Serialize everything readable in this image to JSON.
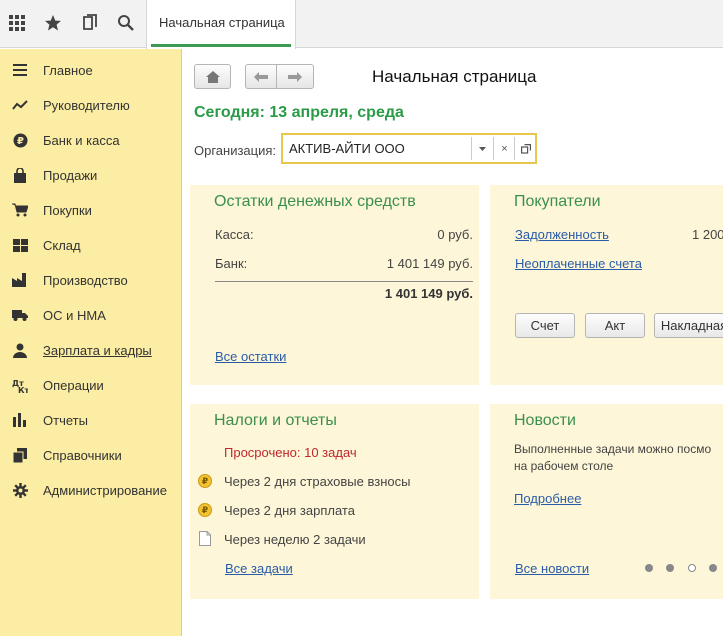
{
  "topbar": {
    "tab_label": "Начальная страница"
  },
  "sidebar": {
    "items": [
      {
        "label": "Главное",
        "icon": "menu-icon"
      },
      {
        "label": "Руководителю",
        "icon": "trend-icon"
      },
      {
        "label": "Банк и касса",
        "icon": "ruble-icon"
      },
      {
        "label": "Продажи",
        "icon": "bag-icon"
      },
      {
        "label": "Покупки",
        "icon": "cart-icon"
      },
      {
        "label": "Склад",
        "icon": "grid-icon"
      },
      {
        "label": "Производство",
        "icon": "factory-icon"
      },
      {
        "label": "ОС и НМА",
        "icon": "truck-icon"
      },
      {
        "label": "Зарплата и кадры",
        "icon": "person-icon"
      },
      {
        "label": "Операции",
        "icon": "dtkt-icon"
      },
      {
        "label": "Отчеты",
        "icon": "bar-chart-icon"
      },
      {
        "label": "Справочники",
        "icon": "books-icon"
      },
      {
        "label": "Администрирование",
        "icon": "gear-icon"
      }
    ]
  },
  "main": {
    "title": "Начальная страница",
    "today": "Сегодня: 13 апреля, среда",
    "org_label": "Организация:",
    "org_value": "АКТИВ-АЙТИ ООО",
    "org_clear": "×"
  },
  "cash_panel": {
    "title": "Остатки денежных средств",
    "rows": [
      {
        "label": "Касса:",
        "value": "0 руб."
      },
      {
        "label": "Банк:",
        "value": "1 401 149 руб."
      }
    ],
    "total": "1 401 149 руб.",
    "link": "Все остатки"
  },
  "buyers_panel": {
    "title": "Покупатели",
    "debt_link": "Задолженность",
    "debt_value": "1 200",
    "unpaid_link": "Неоплаченные счета",
    "buttons": [
      "Счет",
      "Акт",
      "Накладная"
    ]
  },
  "taxes_panel": {
    "title": "Налоги и отчеты",
    "overdue": "Просрочено: 10 задач",
    "tasks": [
      {
        "text": "Через 2 дня страховые взносы",
        "icon": "coin-icon"
      },
      {
        "text": "Через 2 дня зарплата",
        "icon": "coin-icon"
      },
      {
        "text": "Через неделю 2 задачи",
        "icon": "doc-icon"
      }
    ],
    "coin_glyph": "₽",
    "link": "Все задачи"
  },
  "news_panel": {
    "title": "Новости",
    "text_line1": "Выполненные задачи можно посмо",
    "text_line2": "на рабочем столе",
    "more_link": "Подробнее",
    "all_link": "Все новости"
  },
  "colors": {
    "sidebar_bg": "#fbeda3",
    "panel_bg": "#fdf6d8",
    "accent_green": "#2a9b47",
    "link_blue": "#2a5ca8",
    "overdue_red": "#c0282d"
  }
}
